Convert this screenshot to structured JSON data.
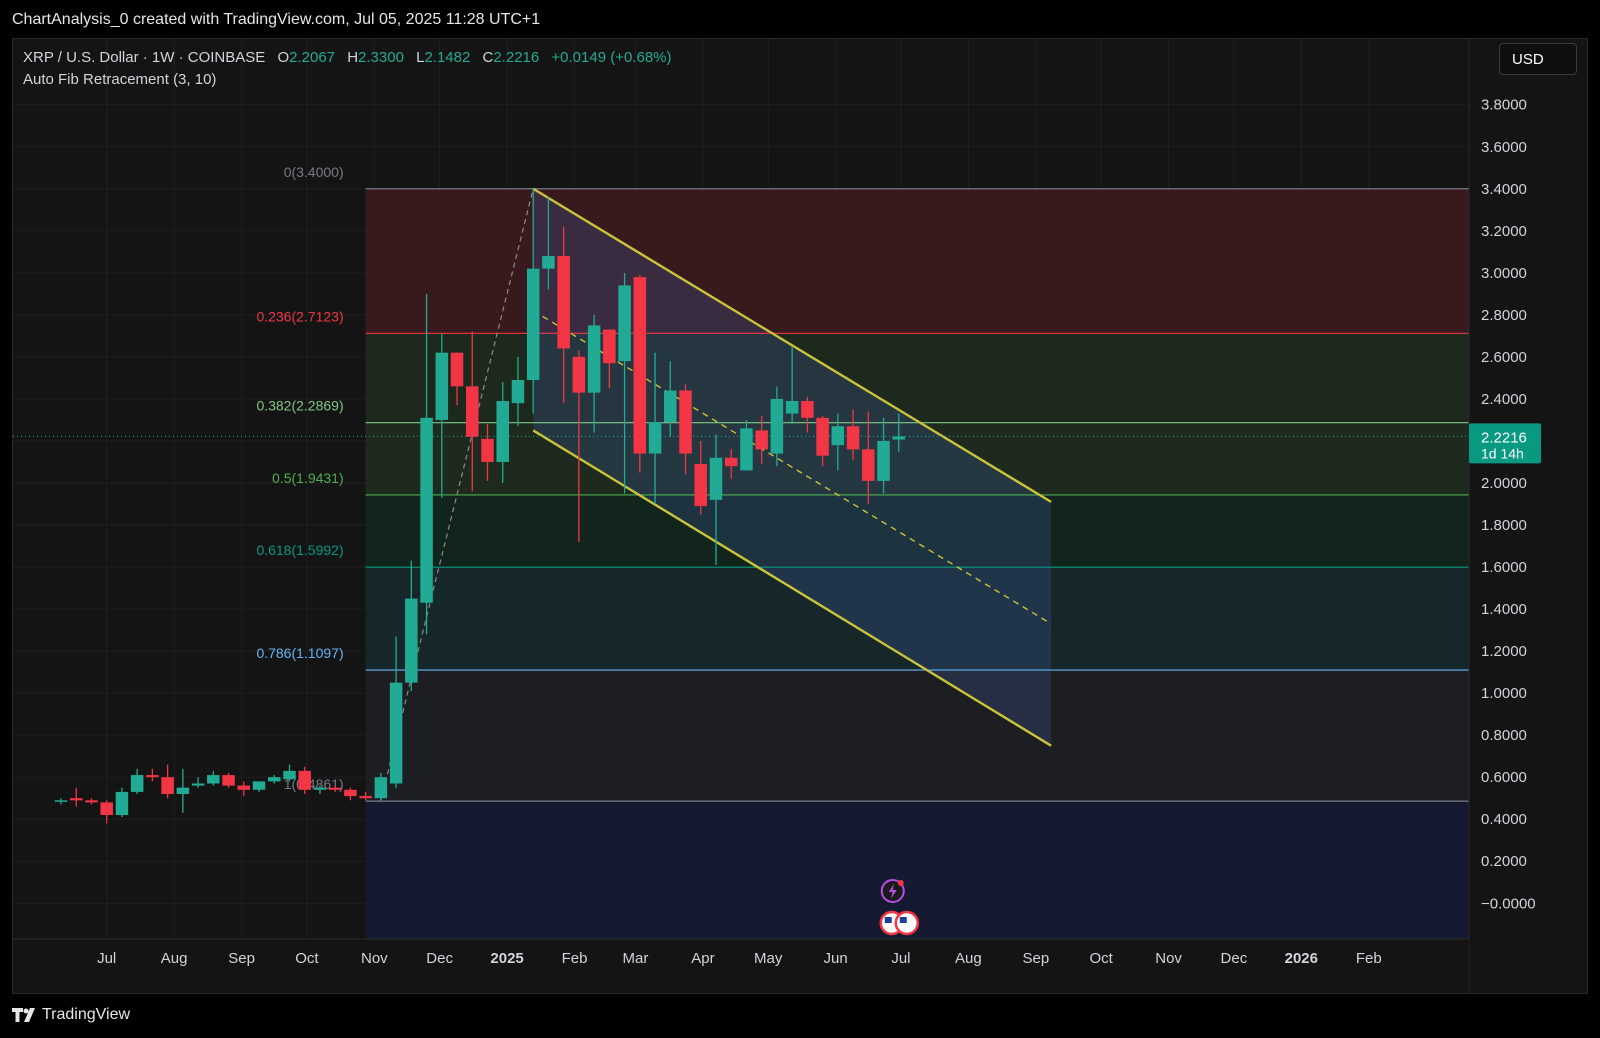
{
  "header": {
    "credit": "ChartAnalysis_0 created with TradingView.com, Jul 05, 2025 11:28 UTC+1"
  },
  "legend": {
    "symbol": "XRP / U.S. Dollar · 1W · COINBASE",
    "open_label": "O",
    "open": "2.2067",
    "high_label": "H",
    "high": "2.3300",
    "low_label": "L",
    "low": "2.1482",
    "close_label": "C",
    "close": "2.2216",
    "change": "+0.0149 (+0.68%)",
    "indicator": "Auto Fib Retracement (3, 10)"
  },
  "currency_button": "USD",
  "footer": {
    "brand": "TradingView"
  },
  "colors": {
    "up": "#22ab94",
    "down": "#f23645",
    "channel": "#c9c23a",
    "background": "#141414"
  },
  "chart_data": {
    "type": "candlestick",
    "symbol": "XRP/USD",
    "interval": "1W",
    "exchange": "COINBASE",
    "ylim": [
      -0.17,
      3.97
    ],
    "y_ticks": [
      "3.8000",
      "3.6000",
      "3.4000",
      "3.2000",
      "3.0000",
      "2.8000",
      "2.6000",
      "2.4000",
      "2.2000",
      "2.0000",
      "1.8000",
      "1.6000",
      "1.4000",
      "1.2000",
      "1.0000",
      "0.8000",
      "0.6000",
      "0.4000",
      "0.2000",
      "−0.0000"
    ],
    "y_tick_values": [
      3.8,
      3.6,
      3.4,
      3.2,
      3.0,
      2.8,
      2.6,
      2.4,
      2.2,
      2.0,
      1.8,
      1.6,
      1.4,
      1.2,
      1.0,
      0.8,
      0.6,
      0.4,
      0.2,
      0.0
    ],
    "x_ticks": [
      {
        "label": "Jul",
        "date": "2024-07-01",
        "bold": false
      },
      {
        "label": "Aug",
        "date": "2024-08-01",
        "bold": false
      },
      {
        "label": "Sep",
        "date": "2024-09-01",
        "bold": false
      },
      {
        "label": "Oct",
        "date": "2024-10-01",
        "bold": false
      },
      {
        "label": "Nov",
        "date": "2024-11-01",
        "bold": false
      },
      {
        "label": "Dec",
        "date": "2024-12-01",
        "bold": false
      },
      {
        "label": "2025",
        "date": "2025-01-01",
        "bold": true
      },
      {
        "label": "Feb",
        "date": "2025-02-01",
        "bold": false
      },
      {
        "label": "Mar",
        "date": "2025-03-01",
        "bold": false
      },
      {
        "label": "Apr",
        "date": "2025-04-01",
        "bold": false
      },
      {
        "label": "May",
        "date": "2025-05-01",
        "bold": false
      },
      {
        "label": "Jun",
        "date": "2025-06-01",
        "bold": false
      },
      {
        "label": "Jul",
        "date": "2025-07-01",
        "bold": false
      },
      {
        "label": "Aug",
        "date": "2025-08-01",
        "bold": false
      },
      {
        "label": "Sep",
        "date": "2025-09-01",
        "bold": false
      },
      {
        "label": "Oct",
        "date": "2025-10-01",
        "bold": false
      },
      {
        "label": "Nov",
        "date": "2025-11-01",
        "bold": false
      },
      {
        "label": "Dec",
        "date": "2025-12-01",
        "bold": false
      },
      {
        "label": "2026",
        "date": "2026-01-01",
        "bold": true
      },
      {
        "label": "Feb",
        "date": "2026-02-01",
        "bold": false
      }
    ],
    "x_range": [
      "2024-06-10",
      "2026-02-25"
    ],
    "current_price": {
      "value": 2.2216,
      "label": "2.2216",
      "countdown": "1d 14h"
    },
    "fib_levels": [
      {
        "label": "0(3.4000)",
        "value": 3.4,
        "line": "#787b86",
        "fill": "#3a1a1e",
        "text": "#787b86"
      },
      {
        "label": "0.236(2.7123)",
        "value": 2.7123,
        "line": "#f23645",
        "fill": "#1f2a1f",
        "text": "#f23645"
      },
      {
        "label": "0.382(2.2869)",
        "value": 2.2869,
        "line": "#81c784",
        "fill": "#1d2b1d",
        "text": "#81c784"
      },
      {
        "label": "0.5(1.9431)",
        "value": 1.9431,
        "line": "#4caf50",
        "fill": "#12261c",
        "text": "#4caf50"
      },
      {
        "label": "0.618(1.5992)",
        "value": 1.5992,
        "line": "#089981",
        "fill": "#16282a",
        "text": "#089981"
      },
      {
        "label": "0.786(1.1097)",
        "value": 1.1097,
        "line": "#64b5f6",
        "fill": "#1d1f22",
        "text": "#64b5f6"
      },
      {
        "label": "1(0.4861)",
        "value": 0.4861,
        "line": "#787b86",
        "fill": "#151a33",
        "text": "#787b86"
      }
    ],
    "fib_start": "2024-10-28",
    "fib_end": "2026-02-25",
    "fib_trend_from": {
      "date": "2024-11-04",
      "value": 0.49
    },
    "fib_trend_to": {
      "date": "2025-01-13",
      "value": 3.4
    },
    "channel": {
      "upper": [
        {
          "date": "2025-01-13",
          "value": 3.4
        },
        {
          "date": "2025-09-08",
          "value": 1.91
        }
      ],
      "lower": [
        {
          "date": "2025-01-13",
          "value": 2.25
        },
        {
          "date": "2025-09-08",
          "value": 0.75
        }
      ],
      "mid": [
        {
          "date": "2025-01-13",
          "value": 2.82
        },
        {
          "date": "2025-09-08",
          "value": 1.33
        }
      ],
      "fill_bottom_date": "2025-09-08"
    },
    "candles": [
      {
        "d": "2024-06-10",
        "o": 0.49,
        "h": 0.5,
        "l": 0.47,
        "c": 0.49
      },
      {
        "d": "2024-06-17",
        "o": 0.5,
        "h": 0.55,
        "l": 0.46,
        "c": 0.49
      },
      {
        "d": "2024-06-24",
        "o": 0.49,
        "h": 0.5,
        "l": 0.47,
        "c": 0.48
      },
      {
        "d": "2024-07-01",
        "o": 0.48,
        "h": 0.49,
        "l": 0.38,
        "c": 0.42
      },
      {
        "d": "2024-07-08",
        "o": 0.42,
        "h": 0.55,
        "l": 0.41,
        "c": 0.53
      },
      {
        "d": "2024-07-15",
        "o": 0.53,
        "h": 0.64,
        "l": 0.52,
        "c": 0.61
      },
      {
        "d": "2024-07-22",
        "o": 0.61,
        "h": 0.64,
        "l": 0.58,
        "c": 0.6
      },
      {
        "d": "2024-07-29",
        "o": 0.6,
        "h": 0.66,
        "l": 0.5,
        "c": 0.52
      },
      {
        "d": "2024-08-05",
        "o": 0.52,
        "h": 0.64,
        "l": 0.43,
        "c": 0.55
      },
      {
        "d": "2024-08-12",
        "o": 0.56,
        "h": 0.6,
        "l": 0.55,
        "c": 0.57
      },
      {
        "d": "2024-08-19",
        "o": 0.57,
        "h": 0.63,
        "l": 0.56,
        "c": 0.61
      },
      {
        "d": "2024-08-26",
        "o": 0.61,
        "h": 0.62,
        "l": 0.55,
        "c": 0.56
      },
      {
        "d": "2024-09-02",
        "o": 0.56,
        "h": 0.58,
        "l": 0.51,
        "c": 0.54
      },
      {
        "d": "2024-09-09",
        "o": 0.54,
        "h": 0.58,
        "l": 0.53,
        "c": 0.58
      },
      {
        "d": "2024-09-16",
        "o": 0.58,
        "h": 0.61,
        "l": 0.57,
        "c": 0.6
      },
      {
        "d": "2024-09-23",
        "o": 0.59,
        "h": 0.66,
        "l": 0.58,
        "c": 0.63
      },
      {
        "d": "2024-09-30",
        "o": 0.63,
        "h": 0.65,
        "l": 0.52,
        "c": 0.54
      },
      {
        "d": "2024-10-07",
        "o": 0.54,
        "h": 0.56,
        "l": 0.52,
        "c": 0.55
      },
      {
        "d": "2024-10-14",
        "o": 0.55,
        "h": 0.56,
        "l": 0.53,
        "c": 0.54
      },
      {
        "d": "2024-10-21",
        "o": 0.54,
        "h": 0.55,
        "l": 0.49,
        "c": 0.51
      },
      {
        "d": "2024-10-28",
        "o": 0.51,
        "h": 0.53,
        "l": 0.49,
        "c": 0.5
      },
      {
        "d": "2024-11-04",
        "o": 0.5,
        "h": 0.62,
        "l": 0.49,
        "c": 0.6
      },
      {
        "d": "2024-11-11",
        "o": 0.57,
        "h": 1.27,
        "l": 0.55,
        "c": 1.05
      },
      {
        "d": "2024-11-18",
        "o": 1.05,
        "h": 1.63,
        "l": 1.01,
        "c": 1.45
      },
      {
        "d": "2024-11-25",
        "o": 1.43,
        "h": 2.9,
        "l": 1.28,
        "c": 2.31
      },
      {
        "d": "2024-12-02",
        "o": 2.3,
        "h": 2.71,
        "l": 1.93,
        "c": 2.62
      },
      {
        "d": "2024-12-09",
        "o": 2.62,
        "h": 2.62,
        "l": 2.37,
        "c": 2.46
      },
      {
        "d": "2024-12-16",
        "o": 2.46,
        "h": 2.72,
        "l": 1.96,
        "c": 2.22
      },
      {
        "d": "2024-12-23",
        "o": 2.21,
        "h": 2.28,
        "l": 2.01,
        "c": 2.1
      },
      {
        "d": "2024-12-30",
        "o": 2.1,
        "h": 2.48,
        "l": 2.0,
        "c": 2.39
      },
      {
        "d": "2025-01-06",
        "o": 2.38,
        "h": 2.6,
        "l": 2.27,
        "c": 2.49
      },
      {
        "d": "2025-01-13",
        "o": 2.49,
        "h": 3.4,
        "l": 2.33,
        "c": 3.02
      },
      {
        "d": "2025-01-20",
        "o": 3.02,
        "h": 3.36,
        "l": 2.92,
        "c": 3.08
      },
      {
        "d": "2025-01-27",
        "o": 3.08,
        "h": 3.22,
        "l": 2.38,
        "c": 2.64
      },
      {
        "d": "2025-02-03",
        "o": 2.6,
        "h": 2.63,
        "l": 1.72,
        "c": 2.43
      },
      {
        "d": "2025-02-10",
        "o": 2.43,
        "h": 2.8,
        "l": 2.24,
        "c": 2.75
      },
      {
        "d": "2025-02-17",
        "o": 2.73,
        "h": 2.73,
        "l": 2.45,
        "c": 2.57
      },
      {
        "d": "2025-02-24",
        "o": 2.58,
        "h": 3.0,
        "l": 1.95,
        "c": 2.94
      },
      {
        "d": "2025-03-03",
        "o": 2.98,
        "h": 2.99,
        "l": 2.05,
        "c": 2.14
      },
      {
        "d": "2025-03-10",
        "o": 2.14,
        "h": 2.62,
        "l": 1.9,
        "c": 2.29
      },
      {
        "d": "2025-03-17",
        "o": 2.29,
        "h": 2.58,
        "l": 2.22,
        "c": 2.44
      },
      {
        "d": "2025-03-24",
        "o": 2.44,
        "h": 2.47,
        "l": 2.04,
        "c": 2.14
      },
      {
        "d": "2025-03-31",
        "o": 2.09,
        "h": 2.2,
        "l": 1.85,
        "c": 1.89
      },
      {
        "d": "2025-04-07",
        "o": 1.92,
        "h": 2.23,
        "l": 1.61,
        "c": 2.12
      },
      {
        "d": "2025-04-14",
        "o": 2.12,
        "h": 2.16,
        "l": 2.02,
        "c": 2.08
      },
      {
        "d": "2025-04-21",
        "o": 2.06,
        "h": 2.3,
        "l": 2.06,
        "c": 2.26
      },
      {
        "d": "2025-04-28",
        "o": 2.25,
        "h": 2.32,
        "l": 2.09,
        "c": 2.16
      },
      {
        "d": "2025-05-05",
        "o": 2.14,
        "h": 2.46,
        "l": 2.08,
        "c": 2.4
      },
      {
        "d": "2025-05-12",
        "o": 2.33,
        "h": 2.65,
        "l": 2.28,
        "c": 2.39
      },
      {
        "d": "2025-05-19",
        "o": 2.39,
        "h": 2.41,
        "l": 2.24,
        "c": 2.31
      },
      {
        "d": "2025-05-26",
        "o": 2.31,
        "h": 2.32,
        "l": 2.08,
        "c": 2.13
      },
      {
        "d": "2025-06-02",
        "o": 2.18,
        "h": 2.33,
        "l": 2.06,
        "c": 2.27
      },
      {
        "d": "2025-06-09",
        "o": 2.27,
        "h": 2.35,
        "l": 2.11,
        "c": 2.16
      },
      {
        "d": "2025-06-16",
        "o": 2.16,
        "h": 2.34,
        "l": 1.9,
        "c": 2.01
      },
      {
        "d": "2025-06-23",
        "o": 2.01,
        "h": 2.31,
        "l": 1.95,
        "c": 2.2
      },
      {
        "d": "2025-06-30",
        "o": 2.2067,
        "h": 2.33,
        "l": 2.1482,
        "c": 2.2216
      }
    ]
  }
}
